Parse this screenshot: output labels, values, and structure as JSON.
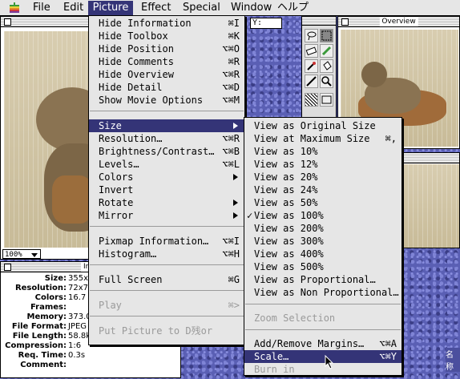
{
  "menubar": {
    "items": [
      "File",
      "Edit",
      "Picture",
      "Effect",
      "Special",
      "Window",
      "ヘルプ"
    ]
  },
  "picture_menu": {
    "title": "Picture",
    "items": [
      {
        "label": "Hide Information",
        "shortcut": "⌘I"
      },
      {
        "label": "Hide Toolbox",
        "shortcut": "⌘K"
      },
      {
        "label": "Hide Position",
        "shortcut": "⌥⌘O"
      },
      {
        "label": "Hide Comments",
        "shortcut": "⌘R"
      },
      {
        "label": "Hide Overview",
        "shortcut": "⌥⌘R"
      },
      {
        "label": "Hide Detail",
        "shortcut": "⌥⌘D"
      },
      {
        "label": "Show Movie Options",
        "shortcut": "⌥⌘M"
      },
      {
        "label": "Size",
        "shortcut": ""
      },
      {
        "label": "Resolution…",
        "shortcut": "⌥⌘R"
      },
      {
        "label": "Brightness/Contrast…",
        "shortcut": "⌥⌘B"
      },
      {
        "label": "Levels…",
        "shortcut": "⌥⌘L"
      },
      {
        "label": "Colors",
        "shortcut": ""
      },
      {
        "label": "Invert",
        "shortcut": ""
      },
      {
        "label": "Rotate",
        "shortcut": ""
      },
      {
        "label": "Mirror",
        "shortcut": ""
      },
      {
        "label": "Pixmap Information…",
        "shortcut": "⌥⌘I"
      },
      {
        "label": "Histogram…",
        "shortcut": "⌥⌘H"
      },
      {
        "label": "Full Screen",
        "shortcut": "⌘G"
      },
      {
        "label": "Play",
        "shortcut": "⌘>"
      },
      {
        "label": "Put Picture to D残or",
        "shortcut": ""
      }
    ]
  },
  "size_menu": {
    "items": [
      {
        "label": "View as Original Size",
        "shortcut": ""
      },
      {
        "label": "View at Maximum Size",
        "shortcut": "⌘,"
      },
      {
        "label": "View as 10%",
        "shortcut": ""
      },
      {
        "label": "View as 12%",
        "shortcut": ""
      },
      {
        "label": "View as 20%",
        "shortcut": ""
      },
      {
        "label": "View as 24%",
        "shortcut": ""
      },
      {
        "label": "View as 50%",
        "shortcut": ""
      },
      {
        "label": "View as 100%",
        "shortcut": ""
      },
      {
        "label": "View as 200%",
        "shortcut": ""
      },
      {
        "label": "View as 300%",
        "shortcut": ""
      },
      {
        "label": "View as 400%",
        "shortcut": ""
      },
      {
        "label": "View as 500%",
        "shortcut": ""
      },
      {
        "label": "View as Proportional…",
        "shortcut": ""
      },
      {
        "label": "View as Non Proportional…",
        "shortcut": ""
      },
      {
        "label": "Zoom Selection",
        "shortcut": ""
      },
      {
        "label": "Add/Remove Margins…",
        "shortcut": "⌥⌘A"
      },
      {
        "label": "Scale…",
        "shortcut": "⌥⌘Y"
      },
      {
        "label": "Burn in",
        "shortcut": ""
      }
    ],
    "checked_item": "View as 100%"
  },
  "zoom_popup": "100%",
  "position": {
    "y_label": "Y:"
  },
  "overview": {
    "title": "Overview"
  },
  "info": {
    "title": "Infor",
    "rows": [
      {
        "key": "Size:",
        "value": "355x"
      },
      {
        "key": "Resolution:",
        "value": "72x7"
      },
      {
        "key": "Colors:",
        "value": "16.7"
      },
      {
        "key": "Frames:",
        "value": ""
      },
      {
        "key": "Memory:",
        "value": "373.0"
      },
      {
        "key": "File Format:",
        "value": "JPEG"
      },
      {
        "key": "File Length:",
        "value": "58.8kB"
      },
      {
        "key": "Compression:",
        "value": "1:6"
      },
      {
        "key": "Req. Time:",
        "value": "0.3s"
      },
      {
        "key": "Comment:",
        "value": ""
      }
    ]
  },
  "desktop_label": "名称",
  "colors": {
    "highlight": "#343477",
    "menu_bg": "#e6e6e6"
  }
}
